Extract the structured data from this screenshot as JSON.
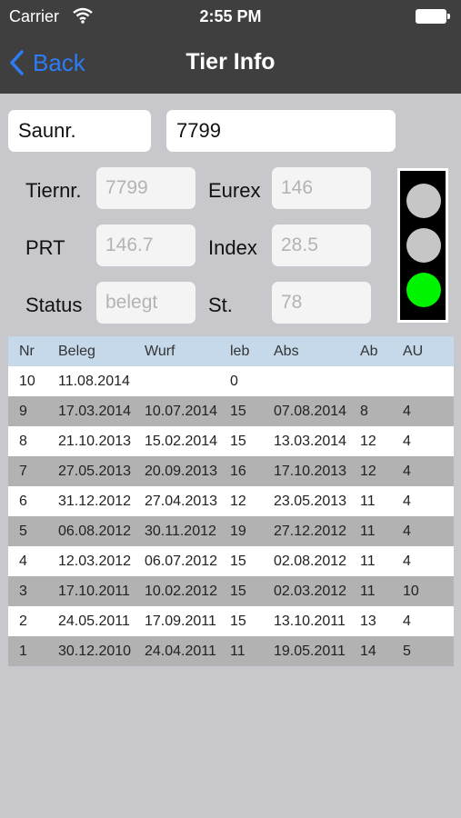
{
  "status_bar": {
    "carrier": "Carrier",
    "time": "2:55 PM"
  },
  "nav": {
    "back_label": "Back",
    "title": "Tier Info"
  },
  "search": {
    "label": "Saunr.",
    "value": "7799"
  },
  "info": {
    "tiernr_label": "Tiernr.",
    "tiernr_value": "7799",
    "eurex_label": "Eurex",
    "eurex_value": "146",
    "prt_label": "PRT",
    "prt_value": "146.7",
    "index_label": "Index",
    "index_value": "28.5",
    "status_label": "Status",
    "status_value": "belegt",
    "st_label": "St.",
    "st_value": "78"
  },
  "traffic_light": {
    "top": "#c6c6c6",
    "middle": "#c6c6c6",
    "bottom": "#00f400",
    "active": "green"
  },
  "table": {
    "headers": [
      "Nr",
      "Beleg",
      "Wurf",
      "leb",
      "Abs",
      "Ab",
      "AU"
    ],
    "rows": [
      [
        "10",
        "11.08.2014",
        "",
        "0",
        "",
        "",
        ""
      ],
      [
        "9",
        "17.03.2014",
        "10.07.2014",
        "15",
        "07.08.2014",
        "8",
        "4"
      ],
      [
        "8",
        "21.10.2013",
        "15.02.2014",
        "15",
        "13.03.2014",
        "12",
        "4"
      ],
      [
        "7",
        "27.05.2013",
        "20.09.2013",
        "16",
        "17.10.2013",
        "12",
        "4"
      ],
      [
        "6",
        "31.12.2012",
        "27.04.2013",
        "12",
        "23.05.2013",
        "11",
        "4"
      ],
      [
        "5",
        "06.08.2012",
        "30.11.2012",
        "19",
        "27.12.2012",
        "11",
        "4"
      ],
      [
        "4",
        "12.03.2012",
        "06.07.2012",
        "15",
        "02.08.2012",
        "11",
        "4"
      ],
      [
        "3",
        "17.10.2011",
        "10.02.2012",
        "15",
        "02.03.2012",
        "11",
        "10"
      ],
      [
        "2",
        "24.05.2011",
        "17.09.2011",
        "15",
        "13.10.2011",
        "13",
        "4"
      ],
      [
        "1",
        "30.12.2010",
        "24.04.2011",
        "11",
        "19.05.2011",
        "14",
        "5"
      ]
    ]
  }
}
